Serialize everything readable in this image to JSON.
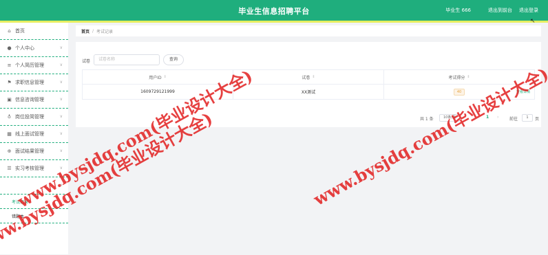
{
  "header": {
    "title": "毕业生信息招聘平台",
    "user": "毕业生 666",
    "back_to_admin": "退出到前台",
    "logout": "退出登录"
  },
  "sidebar": {
    "items": [
      {
        "label": "首页",
        "icon": "home-icon"
      },
      {
        "label": "个人中心",
        "icon": "user-icon"
      },
      {
        "label": "个人简历管理",
        "icon": "list-icon"
      },
      {
        "label": "求职信息管理",
        "icon": "flag-icon"
      },
      {
        "label": "信息咨询管理",
        "icon": "briefcase-icon"
      },
      {
        "label": "岗位投简管理",
        "icon": "mic-icon"
      },
      {
        "label": "线上面试管理",
        "icon": "grid-icon"
      },
      {
        "label": "面试结果管理",
        "icon": "circle-plus-icon"
      },
      {
        "label": "实习考核管理",
        "icon": "sliders-icon"
      }
    ],
    "sub_items": [
      {
        "label": "考试记录"
      },
      {
        "label": "错题本"
      }
    ]
  },
  "breadcrumb": {
    "home": "首页",
    "separator": "/",
    "current": "考试记录"
  },
  "search": {
    "label": "试卷",
    "placeholder": "试卷名称",
    "button": "查询"
  },
  "table": {
    "headers": [
      "用户ID",
      "试卷",
      "考试得分"
    ],
    "rows": [
      {
        "user_id": "1609729121999",
        "paper": "XX测试",
        "score": "40",
        "action": "查看详情"
      }
    ]
  },
  "pagination": {
    "total": "共 1 条",
    "page_size": "10条/页",
    "current_page": "1",
    "goto_label": "前往",
    "goto_value": "1",
    "unit": "页"
  },
  "watermark": {
    "text": "www.bysjdq.com(毕业设计大全)"
  },
  "colors": {
    "primary": "#1fae7d",
    "accent_strip": "#e6ee61",
    "watermark": "#e21f1f"
  }
}
